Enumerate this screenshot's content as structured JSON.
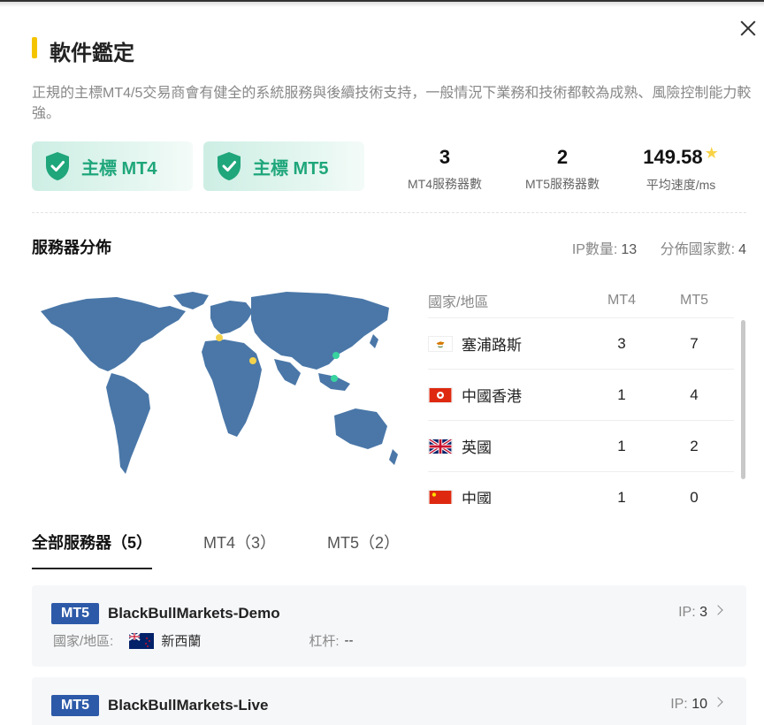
{
  "header": {
    "title": "軟件鑑定",
    "close": "close"
  },
  "description": "正規的主標MT4/5交易商會有健全的系統服務與後續技術支持，一般情況下業務和技術都較為成熟、風險控制能力較強。",
  "badges": [
    {
      "label": "主標 MT4"
    },
    {
      "label": "主標 MT5"
    }
  ],
  "stats": [
    {
      "value": "3",
      "label": "MT4服務器數"
    },
    {
      "value": "2",
      "label": "MT5服務器數"
    },
    {
      "value": "149.58",
      "label": "平均速度/ms"
    }
  ],
  "distribution": {
    "title": "服務器分佈",
    "ip_label": "IP數量:",
    "ip_value": "13",
    "country_label": "分佈國家數:",
    "country_value": "4",
    "table": {
      "headers": [
        "國家/地區",
        "MT4",
        "MT5"
      ],
      "rows": [
        {
          "country": "塞浦路斯",
          "flag": "cyprus-flag",
          "mt4": "3",
          "mt5": "7"
        },
        {
          "country": "中國香港",
          "flag": "hongkong-flag",
          "mt4": "1",
          "mt5": "4"
        },
        {
          "country": "英國",
          "flag": "uk-flag",
          "mt4": "1",
          "mt5": "2"
        },
        {
          "country": "中國",
          "flag": "china-flag",
          "mt4": "1",
          "mt5": "0"
        }
      ]
    }
  },
  "tabs": [
    {
      "label": "全部服務器（5）",
      "active": true
    },
    {
      "label": "MT4（3）"
    },
    {
      "label": "MT5（2）"
    }
  ],
  "servers": [
    {
      "type": "MT5",
      "name": "BlackBullMarkets-Demo",
      "ip_label": "IP:",
      "ip": "3",
      "country_label": "國家/地區:",
      "country": "新西蘭",
      "leverage_label": "杠杆:",
      "leverage": "--"
    },
    {
      "type": "MT5",
      "name": "BlackBullMarkets-Live",
      "ip_label": "IP:",
      "ip": "10"
    }
  ],
  "colors": {
    "accent": "#f5c400",
    "badge_green": "#1fa67a",
    "mt5_tag": "#2d5aa8",
    "map_land": "#4a77a8"
  }
}
